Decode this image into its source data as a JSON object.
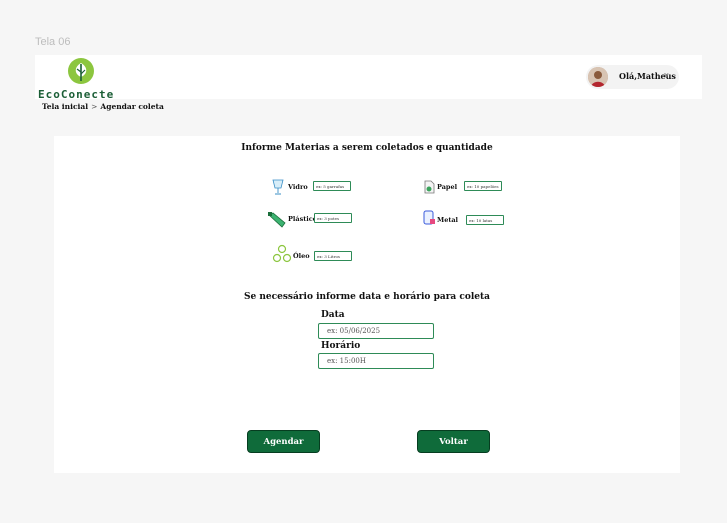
{
  "frame": {
    "label": "Tela 06"
  },
  "header": {
    "logo_text": "EcoConecte",
    "user_greeting": "Olá,Matheus",
    "caret": "v"
  },
  "breadcrumb": {
    "home": "Tela inicial",
    "separator": ">",
    "current": "Agendar coleta"
  },
  "form": {
    "title": "Informe Materias a serem coletados  e quantidade",
    "materials": {
      "vidro": {
        "label": "Vidro",
        "placeholder": "ex: 5 garrafas"
      },
      "papel": {
        "label": "Papel",
        "placeholder": "ex: 10 papelões"
      },
      "plastico": {
        "label": "Plástico",
        "placeholder": "ex: 3 potes"
      },
      "metal": {
        "label": "Metal",
        "placeholder": "ex: 10 latas"
      },
      "oleo": {
        "label": "Óleo",
        "placeholder": "ex: 3 Litros"
      }
    },
    "schedule_title": "Se necessário informe  data e horário para coleta",
    "date": {
      "label": "Data",
      "placeholder": "ex: 05/06/2025"
    },
    "time": {
      "label": "Horário",
      "placeholder": "ex: 15:00H"
    },
    "buttons": {
      "schedule": "Agendar",
      "back": "Voltar"
    }
  },
  "colors": {
    "brand_green": "#0f6b3a",
    "logo_green": "#8cc63f",
    "field_border": "#2e8b57"
  }
}
